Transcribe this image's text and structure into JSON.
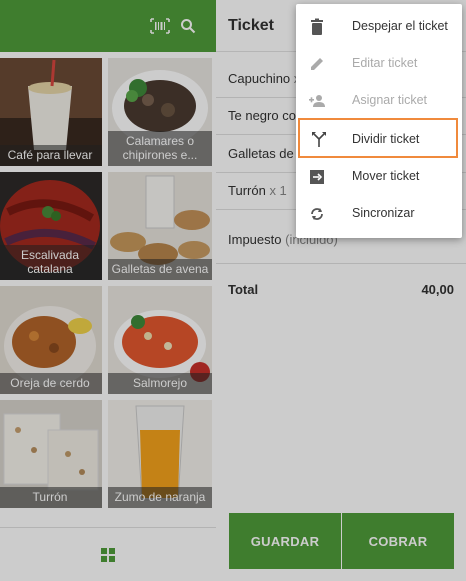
{
  "header": {
    "barcode_icon": "barcode-icon",
    "search_icon": "search-icon"
  },
  "products": [
    {
      "label": "Café para llevar",
      "icon": "coffee-cup"
    },
    {
      "label": "Calamares o chipirones e...",
      "icon": "squid-dish"
    },
    {
      "label": "Escalivada catalana",
      "icon": "roasted-vegetables"
    },
    {
      "label": "Galletas de avena",
      "icon": "cookies"
    },
    {
      "label": "Oreja de cerdo",
      "icon": "pork-dish"
    },
    {
      "label": "Salmorejo",
      "icon": "soup-bowl"
    },
    {
      "label": "Turrón",
      "icon": "nougat"
    },
    {
      "label": "Zumo de naranja",
      "icon": "orange-juice"
    }
  ],
  "footer": {
    "icon": "apps-icon"
  },
  "ticket": {
    "title": "Ticket",
    "items": [
      {
        "name": "Capuchino",
        "qty": "x"
      },
      {
        "name": "Te negro co",
        "qty": ""
      },
      {
        "name": "Galletas de",
        "qty": ""
      },
      {
        "name": "Turrón",
        "qty": "x 1"
      }
    ],
    "tax_label": "Impuesto",
    "tax_note": "(incluido)",
    "total_label": "Total",
    "total_value": "40,00",
    "save_button": "GUARDAR",
    "charge_button": "COBRAR"
  },
  "menu": {
    "items": [
      {
        "label": "Despejar el ticket",
        "icon": "trash-icon",
        "enabled": true
      },
      {
        "label": "Editar ticket",
        "icon": "pencil-icon",
        "enabled": false
      },
      {
        "label": "Asignar ticket",
        "icon": "assign-user-icon",
        "enabled": false
      },
      {
        "label": "Dividir ticket",
        "icon": "split-icon",
        "enabled": true,
        "highlighted": true
      },
      {
        "label": "Mover ticket",
        "icon": "move-icon",
        "enabled": true
      },
      {
        "label": "Sincronizar",
        "icon": "sync-icon",
        "enabled": true
      }
    ]
  },
  "colors": {
    "brand_green": "#4f9d3a",
    "highlight_orange": "#f08a3c"
  }
}
